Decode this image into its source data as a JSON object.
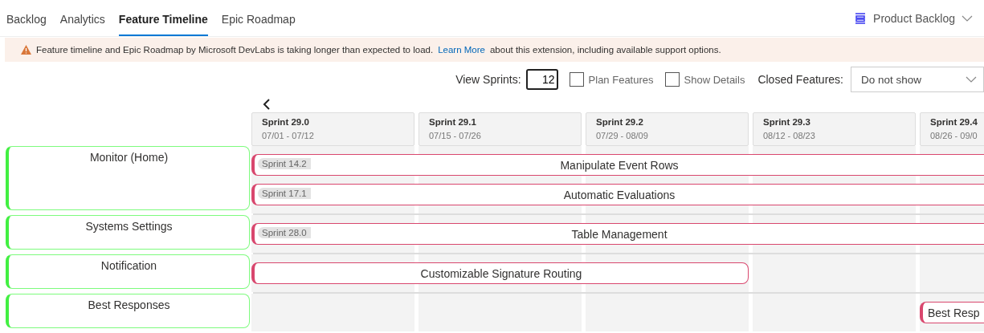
{
  "tabs": [
    {
      "label": "Backlog",
      "selected": false
    },
    {
      "label": "Analytics",
      "selected": false
    },
    {
      "label": "Feature Timeline",
      "selected": true
    },
    {
      "label": "Epic Roadmap",
      "selected": false
    }
  ],
  "backlog_picker": {
    "label": "Product Backlog"
  },
  "banner": {
    "text": "Feature timeline and Epic Roadmap by Microsoft DevLabs is taking longer than expected to load.",
    "link": "Learn More",
    "suffix": "about this extension, including available support options."
  },
  "toolbar": {
    "view_sprints_label": "View Sprints:",
    "view_sprints_value": "12",
    "checkboxes": [
      {
        "label": "Plan Features",
        "checked": false
      },
      {
        "label": "Show Details",
        "checked": false
      }
    ],
    "closed_features_label": "Closed Features:",
    "closed_features_value": "Do not show"
  },
  "sprints": [
    {
      "name": "Sprint 29.0",
      "dates": "07/01 - 07/12"
    },
    {
      "name": "Sprint 29.1",
      "dates": "07/15 - 07/26"
    },
    {
      "name": "Sprint 29.2",
      "dates": "07/29 - 08/09"
    },
    {
      "name": "Sprint 29.3",
      "dates": "08/12 - 08/23"
    },
    {
      "name": "Sprint 29.4",
      "dates": "08/26 - 09/0"
    }
  ],
  "epics": [
    {
      "title": "Monitor (Home)",
      "features": [
        {
          "title": "Manipulate Event Rows",
          "tag": "Sprint 14.2",
          "kind": "ongoing"
        },
        {
          "title": "Automatic Evaluations",
          "tag": "Sprint 17.1",
          "kind": "ongoing"
        }
      ]
    },
    {
      "title": "Systems Settings",
      "features": [
        {
          "title": "Table Management",
          "tag": "Sprint 28.0",
          "kind": "ongoing"
        }
      ]
    },
    {
      "title": "Notification",
      "features": [
        {
          "title": "Customizable Signature Routing",
          "kind": "bounded"
        }
      ]
    },
    {
      "title": "Best Responses",
      "features": [
        {
          "title": "Best Resp",
          "kind": "upcoming"
        }
      ]
    }
  ]
}
